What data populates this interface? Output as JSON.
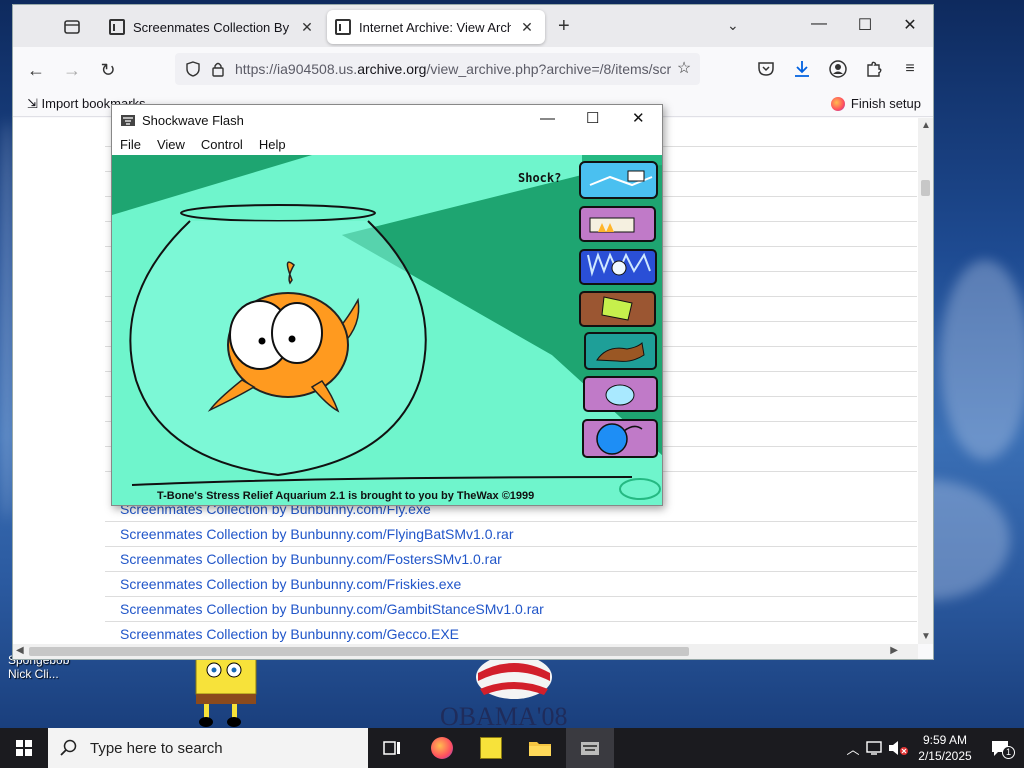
{
  "browser": {
    "tabs": [
      {
        "label": "Screenmates Collection By Bunb",
        "close": "✕",
        "active": false
      },
      {
        "label": "Internet Archive: View Archive",
        "close": "✕",
        "active": true
      }
    ],
    "new_tab": "+",
    "url_prefix": "https://ia904508.us.",
    "url_domain": "archive.org",
    "url_suffix": "/view_archive.php?archive=/8/items/scr",
    "bookmarks": {
      "import": "Import bookmarks",
      "finish_setup": "Finish setup"
    }
  },
  "file_rows": [
    "Screenmates Collection by Bunbunny.com/Fly.exe",
    "Screenmates Collection by Bunbunny.com/FlyingBatSMv1.0.rar",
    "Screenmates Collection by Bunbunny.com/FostersSMv1.0.rar",
    "Screenmates Collection by Bunbunny.com/Friskies.exe",
    "Screenmates Collection by Bunbunny.com/GambitStanceSMv1.0.rar",
    "Screenmates Collection by Bunbunny.com/Gecco.EXE"
  ],
  "flash": {
    "title": "Shockwave Flash",
    "menu": [
      "File",
      "View",
      "Control",
      "Help"
    ],
    "shock_label": "Shock?",
    "footer": "T-Bone's Stress Relief Aquarium 2.1 is brought to you by TheWax ©1999",
    "colors": {
      "light": "#6ff5cc",
      "dark": "#1ea571",
      "fish": "#ff9a1f"
    }
  },
  "desktop": {
    "icon_label": "Spongebob Nick Cli...",
    "obama_text": "OBAMA'08"
  },
  "taskbar": {
    "search_placeholder": "Type here to search",
    "time": "9:59 AM",
    "date": "2/15/2025",
    "notification_count": "1"
  }
}
